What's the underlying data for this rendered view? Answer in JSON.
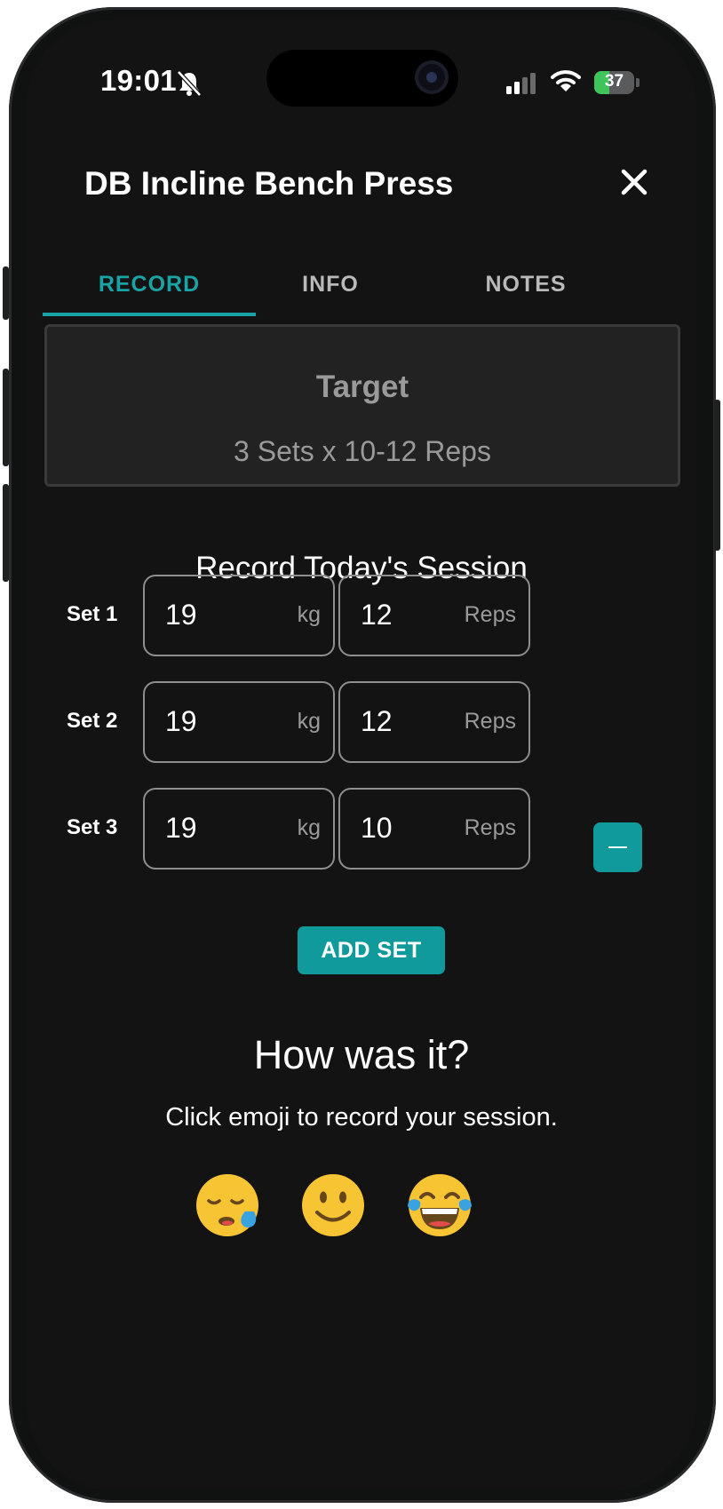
{
  "status_bar": {
    "time": "19:01",
    "battery": "37"
  },
  "header": {
    "title": "DB Incline Bench Press"
  },
  "tabs": [
    {
      "label": "RECORD",
      "active": true
    },
    {
      "label": "INFO",
      "active": false
    },
    {
      "label": "NOTES",
      "active": false
    }
  ],
  "target": {
    "title": "Target",
    "description": "3 Sets x 10-12 Reps"
  },
  "session": {
    "title": "Record Today's Session",
    "sets": [
      {
        "label": "Set 1",
        "weight": "19",
        "weight_unit": "kg",
        "reps": "12",
        "reps_unit": "Reps"
      },
      {
        "label": "Set 2",
        "weight": "19",
        "weight_unit": "kg",
        "reps": "12",
        "reps_unit": "Reps"
      },
      {
        "label": "Set 3",
        "weight": "19",
        "weight_unit": "kg",
        "reps": "10",
        "reps_unit": "Reps"
      }
    ],
    "add_set_label": "ADD SET"
  },
  "feedback": {
    "title": "How was it?",
    "subtitle": "Click emoji to record your session.",
    "emojis": [
      "sleepy-face-icon",
      "slightly-smiling-face-icon",
      "face-with-tears-of-joy-icon"
    ]
  },
  "colors": {
    "accent": "#119a9b",
    "background": "#131313",
    "card": "#222222"
  }
}
